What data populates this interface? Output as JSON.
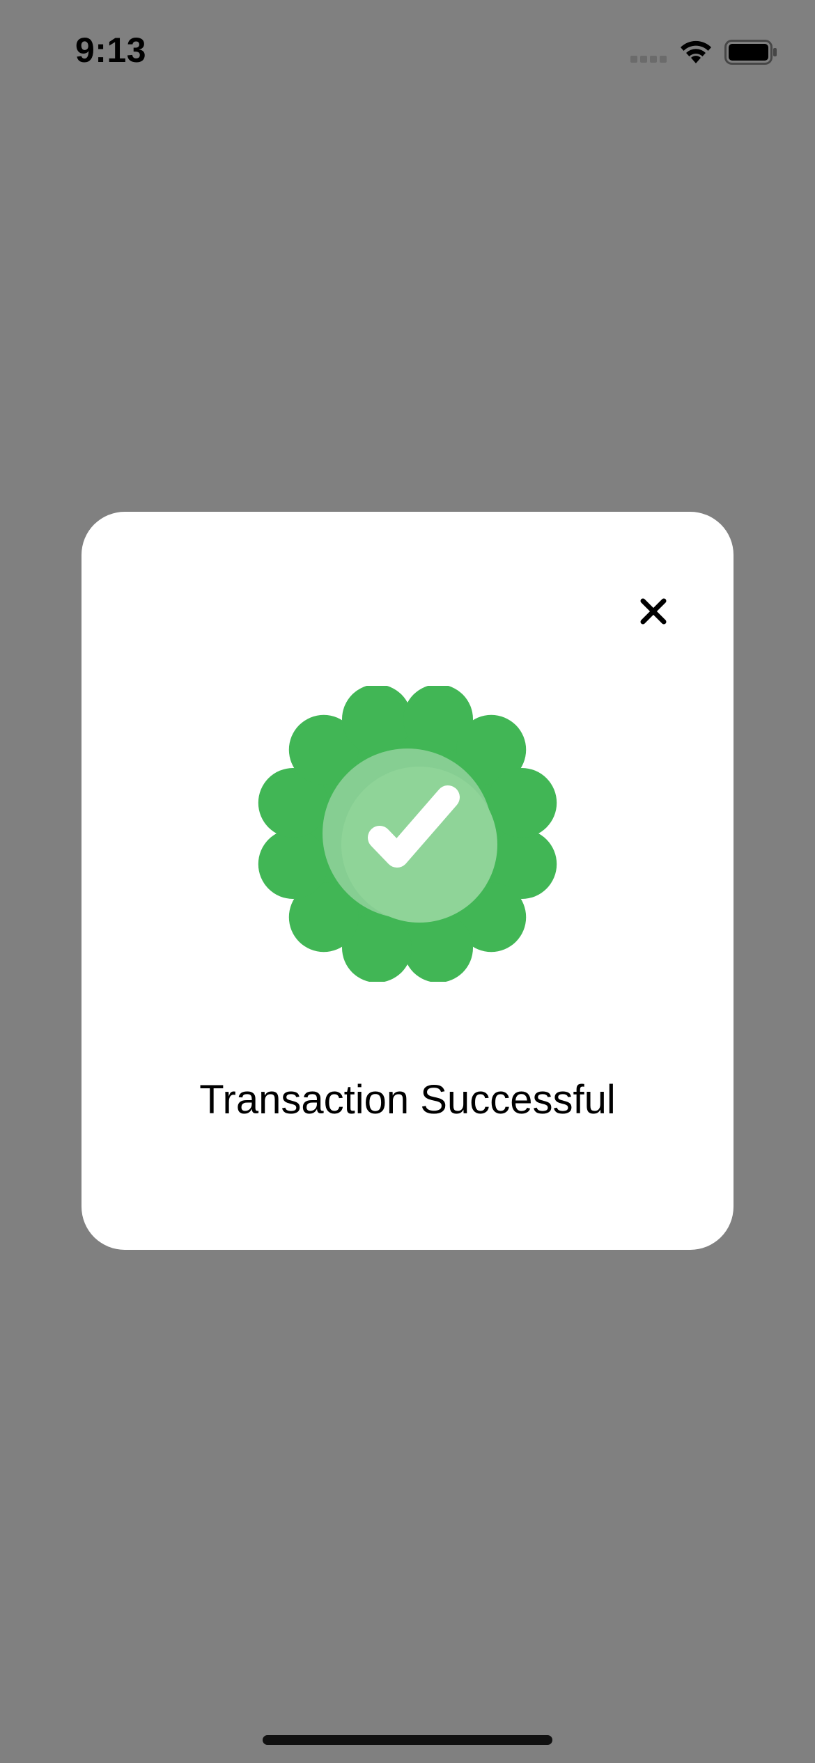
{
  "status_bar": {
    "time": "9:13",
    "signal_icon": "cellular-signal-icon",
    "wifi_icon": "wifi-icon",
    "battery_icon": "battery-icon"
  },
  "modal": {
    "close_icon": "close-icon",
    "badge_icon": "success-badge-check-icon",
    "message": "Transaction Successful"
  },
  "colors": {
    "backdrop": "#808080",
    "modal_background": "#FFFFFF",
    "badge_outer": "#41B655",
    "badge_inner_shadow": "#86CE92",
    "badge_inner": "#8FD498",
    "check": "#FFFFFF",
    "text": "#000000"
  }
}
